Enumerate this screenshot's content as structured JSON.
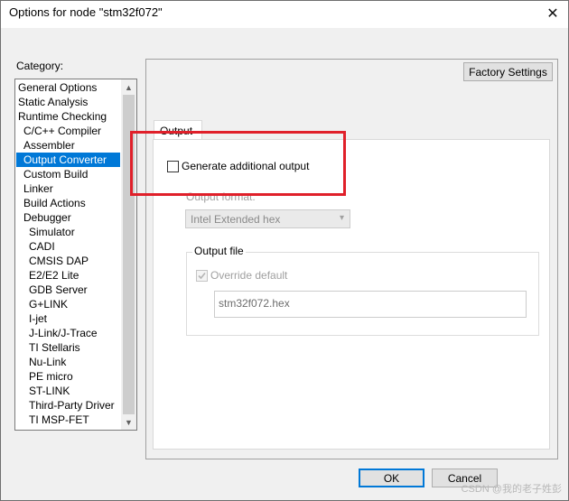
{
  "window": {
    "title": "Options for node \"stm32f072\""
  },
  "category": {
    "label": "Category:",
    "items": [
      "General Options",
      "Static Analysis",
      "Runtime Checking",
      "C/C++ Compiler",
      "Assembler",
      "Output Converter",
      "Custom Build",
      "Linker",
      "Build Actions",
      "Debugger",
      "Simulator",
      "CADI",
      "CMSIS DAP",
      "E2/E2 Lite",
      "GDB Server",
      "G+LINK",
      "I-jet",
      "J-Link/J-Trace",
      "TI Stellaris",
      "Nu-Link",
      "PE micro",
      "ST-LINK",
      "Third-Party Driver",
      "TI MSP-FET"
    ],
    "selected": "Output Converter"
  },
  "buttons": {
    "factory_settings": "Factory Settings",
    "ok": "OK",
    "cancel": "Cancel"
  },
  "output_tab": {
    "tab_label": "Output",
    "generate_label": "Generate additional output",
    "generate_checked": false,
    "format_label": "Output format:",
    "format_value": "Intel Extended hex",
    "output_file_group": "Output file",
    "override_label": "Override default",
    "override_checked": true,
    "file_value": "stm32f072.hex"
  },
  "annotation": {
    "color": "#e0202a"
  },
  "watermark": "CSDN @我的老子姓彭",
  "colors": {
    "selection": "#0078d7",
    "ok_border": "#0078d7"
  }
}
